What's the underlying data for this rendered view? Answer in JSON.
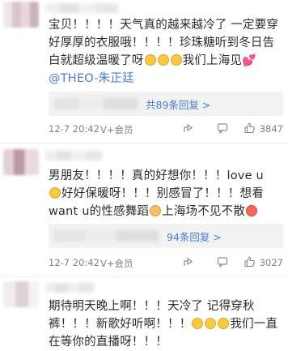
{
  "comments": [
    {
      "text_before_mention": "宝贝！！！！天气真的越来越冷了 一定要穿好厚厚的衣服哦！！！！珍珠糖听到冬日告白就超级温暖了呀",
      "emoji_after_text": [
        "smile",
        "smile",
        "smile"
      ],
      "text_after_emoji": "我们上海见",
      "heart_emoji": "💕",
      "mention": "@THEO-朱正廷",
      "reply_link": "共89条回复 >",
      "date": "12-7 20:42",
      "member": "V+会员",
      "likes": "3847"
    },
    {
      "text_line1": "男朋友！！！！真的好想你！！！love u",
      "text_line2": "好好保暖呀！！！别感冒了！！！想看",
      "text_line3_a": "want u的性感舞蹈",
      "text_line3_b": "上海场不见不散",
      "reply_link": "94条回复 >",
      "date": "12-7 20:42",
      "member": "V+会员",
      "likes": "3027"
    },
    {
      "text_line1": "期待明天晚上啊！！！天冷了 记得穿秋",
      "text_line2_a": "裤！！！新歌好听啊！！！",
      "text_line2_b": "我们一直",
      "text_line3": "在等你的直播呀！！！"
    }
  ],
  "colors": {
    "link": "#4a7cc9",
    "meta": "#808080",
    "reply_bg": "#f2f2f2"
  }
}
